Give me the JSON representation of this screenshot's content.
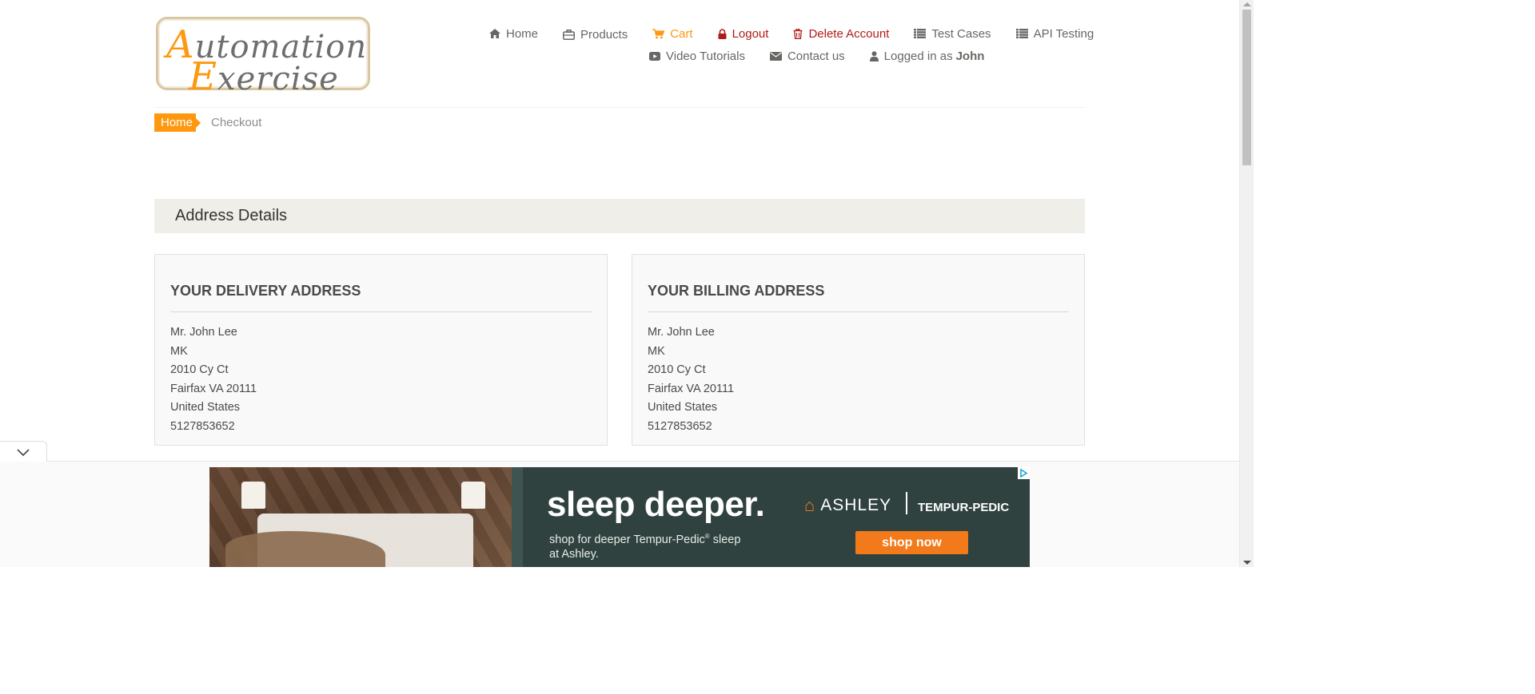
{
  "logo": {
    "line1_cap": "A",
    "line1_rest": "utomation",
    "line2_cap": "E",
    "line2_rest": "xercise"
  },
  "nav": {
    "row1": [
      {
        "label": "Home",
        "icon": "home-icon"
      },
      {
        "label": "Products",
        "icon": "briefcase-icon"
      },
      {
        "label": "Cart",
        "icon": "cart-icon"
      },
      {
        "label": "Logout",
        "icon": "lock-icon"
      },
      {
        "label": "Delete Account",
        "icon": "trash-icon"
      },
      {
        "label": "Test Cases",
        "icon": "list-icon"
      },
      {
        "label": "API Testing",
        "icon": "list-icon"
      }
    ],
    "row2": [
      {
        "label": "Video Tutorials",
        "icon": "youtube-play-icon"
      },
      {
        "label": "Contact us",
        "icon": "envelope-icon"
      },
      {
        "label": "Logged in as",
        "user": "John",
        "icon": "user-icon"
      }
    ]
  },
  "colors": {
    "accent": "#fe980f",
    "danger": "#b01c17",
    "text": "#696763",
    "section_bg": "#efeee8"
  },
  "breadcrumb": {
    "home": "Home",
    "current": "Checkout"
  },
  "address_details": {
    "heading": "Address Details",
    "delivery": {
      "title": "YOUR DELIVERY ADDRESS",
      "lines": [
        "Mr. John Lee",
        "MK",
        "2010 Cy Ct",
        "Fairfax VA 20111",
        "United States",
        "5127853652"
      ]
    },
    "billing": {
      "title": "YOUR BILLING ADDRESS",
      "lines": [
        "Mr. John Lee",
        "MK",
        "2010 Cy Ct",
        "Fairfax VA 20111",
        "United States",
        "5127853652"
      ]
    }
  },
  "ad": {
    "headline": "sleep deeper.",
    "sub_line1": "shop for deeper Tempur-Pedic",
    "sub_reg": "®",
    "sub_line1_end": " sleep",
    "sub_line2": "at Ashley.",
    "brand_ashley": "ASHLEY",
    "brand_tempur": "TEMPUR-PEDIC",
    "button": "shop now"
  }
}
